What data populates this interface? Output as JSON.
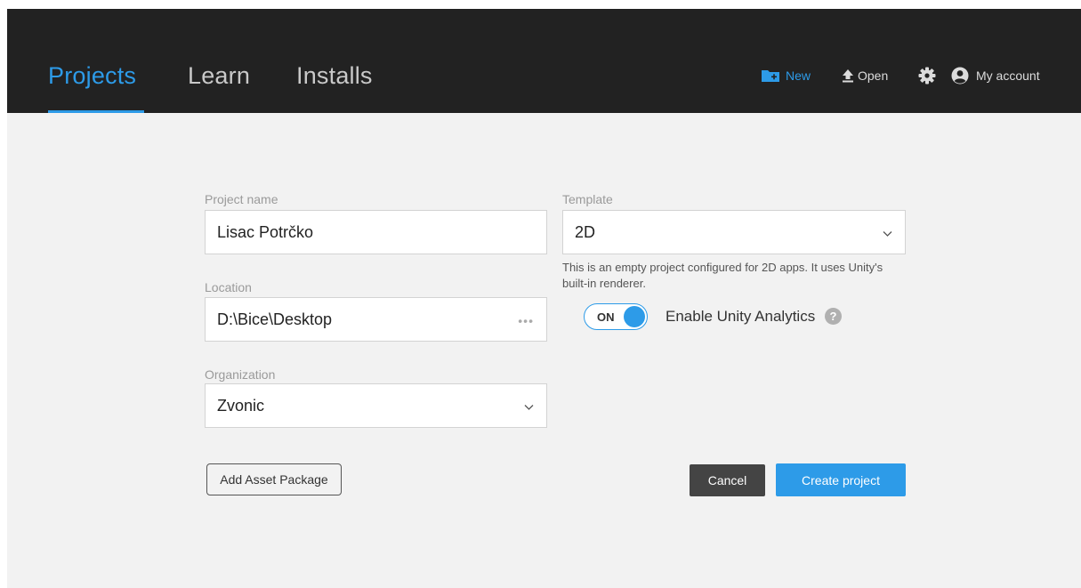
{
  "nav": {
    "tabs": [
      {
        "label": "Projects",
        "active": true
      },
      {
        "label": "Learn",
        "active": false
      },
      {
        "label": "Installs",
        "active": false
      }
    ],
    "actions": {
      "new_label": "New",
      "open_label": "Open",
      "settings_icon": "gear-icon",
      "account_label": "My account"
    }
  },
  "form": {
    "project_name": {
      "label": "Project name",
      "value": "Lisac Potrčko"
    },
    "location": {
      "label": "Location",
      "value": "D:\\Bice\\Desktop",
      "browse": "•••"
    },
    "organization": {
      "label": "Organization",
      "value": "Zvonic"
    },
    "template": {
      "label": "Template",
      "value": "2D",
      "description": "This is an empty project configured for 2D apps. It uses Unity's built-in renderer."
    },
    "analytics": {
      "toggle_label": "ON",
      "enabled": true,
      "label": "Enable Unity Analytics",
      "help": "?"
    }
  },
  "buttons": {
    "add_asset": "Add Asset Package",
    "cancel": "Cancel",
    "create": "Create project"
  },
  "colors": {
    "accent": "#2d9be8",
    "header_bg": "#222222",
    "page_bg": "#f2f2f2",
    "cancel_bg": "#444444"
  }
}
